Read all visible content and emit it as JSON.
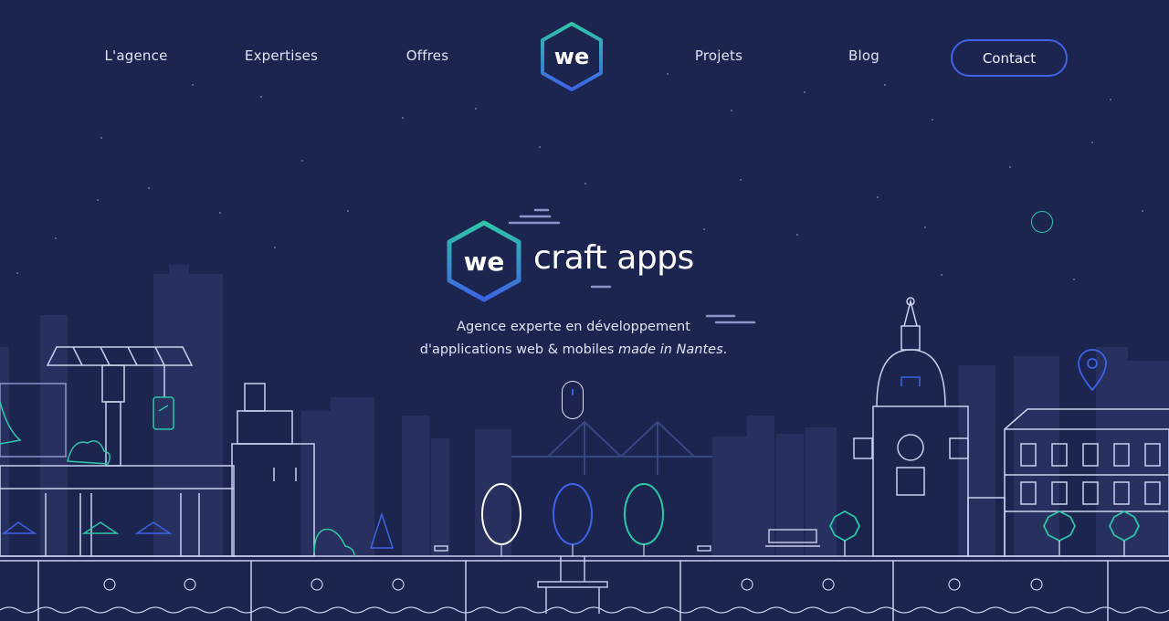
{
  "nav": {
    "links": [
      "L'agence",
      "Expertises",
      "Offres",
      "Projets",
      "Blog"
    ],
    "logo_text": "we",
    "contact_label": "Contact"
  },
  "hero": {
    "logo_text": "we",
    "title": "craft apps",
    "tagline_line1": "Agence experte en développement",
    "tagline_line2_prefix": "d'applications web & mobiles ",
    "tagline_line2_emphasis": "made in Nantes",
    "tagline_line2_suffix": "."
  },
  "colors": {
    "background": "#1c2550",
    "accent_blue": "#3d63e6",
    "accent_teal": "#2fc6a8",
    "line": "#c9d1f0",
    "skyline": "#27305f"
  },
  "icons": [
    "scroll-mouse-icon",
    "location-pin-icon",
    "smartphone-icon",
    "laptop-icon"
  ]
}
